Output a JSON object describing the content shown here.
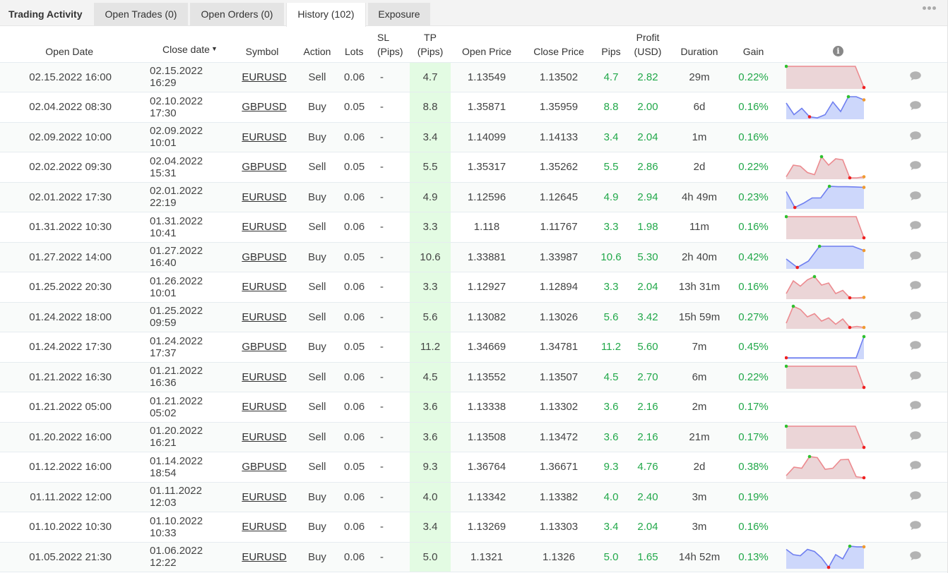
{
  "header": {
    "title": "Trading Activity",
    "tabs": [
      {
        "label": "Open Trades (0)",
        "active": false
      },
      {
        "label": "Open Orders (0)",
        "active": false
      },
      {
        "label": "History (102)",
        "active": true
      },
      {
        "label": "Exposure",
        "active": false
      }
    ],
    "more_icon": "ellipsis-icon"
  },
  "table": {
    "columns": {
      "open_date": "Open Date",
      "close_date": "Close date",
      "close_date_sort": "▼",
      "symbol": "Symbol",
      "action": "Action",
      "lots": "Lots",
      "sl_1": "SL",
      "sl_2": "(Pips)",
      "tp_1": "TP",
      "tp_2": "(Pips)",
      "open_price": "Open Price",
      "close_price": "Close Price",
      "pips": "Pips",
      "profit_1": "Profit",
      "profit_2": "(USD)",
      "duration": "Duration",
      "gain": "Gain",
      "info_icon": "i"
    },
    "colors": {
      "profit_green": "#22a84a",
      "tp_highlight": "#e3fbe3",
      "spark_buy": "#6f7ff0",
      "spark_buy_fill": "#cdd7fb",
      "spark_sell": "#ec8a8f",
      "spark_sell_fill": "#ebd5d7",
      "marker_max": "#2ec12e",
      "marker_min": "#f02020",
      "marker_end": "#f09a30"
    },
    "rows": [
      {
        "open_date": "02.15.2022 16:00",
        "close_date": "02.15.2022 16:29",
        "symbol": "EURUSD",
        "action": "Sell",
        "lots": "0.06",
        "sl": "-",
        "tp": "4.7",
        "open_price": "1.13549",
        "close_price": "1.13502",
        "pips": "4.7",
        "profit": "2.82",
        "duration": "29m",
        "gain": "0.22%",
        "spark": {
          "kind": "sell",
          "values": [
            1,
            1,
            1,
            1,
            1,
            1,
            1,
            1,
            1,
            0
          ],
          "max": 0,
          "min": 9,
          "end": null
        }
      },
      {
        "open_date": "02.04.2022 08:30",
        "close_date": "02.10.2022 17:30",
        "symbol": "GBPUSD",
        "action": "Buy",
        "lots": "0.05",
        "sl": "-",
        "tp": "8.8",
        "open_price": "1.35871",
        "close_price": "1.35959",
        "pips": "8.8",
        "profit": "2.00",
        "duration": "6d",
        "gain": "0.16%",
        "spark": {
          "kind": "buy",
          "values": [
            0.7,
            0.15,
            0.45,
            0.05,
            0.0,
            0.15,
            0.75,
            0.3,
            1.0,
            1.0,
            0.85
          ],
          "max": 8,
          "min": 3,
          "end": 10
        }
      },
      {
        "open_date": "02.09.2022 10:00",
        "close_date": "02.09.2022 10:01",
        "symbol": "EURUSD",
        "action": "Buy",
        "lots": "0.06",
        "sl": "-",
        "tp": "3.4",
        "open_price": "1.14099",
        "close_price": "1.14133",
        "pips": "3.4",
        "profit": "2.04",
        "duration": "1m",
        "gain": "0.16%",
        "spark": null
      },
      {
        "open_date": "02.02.2022 09:30",
        "close_date": "02.04.2022 15:31",
        "symbol": "GBPUSD",
        "action": "Sell",
        "lots": "0.05",
        "sl": "-",
        "tp": "5.5",
        "open_price": "1.35317",
        "close_price": "1.35262",
        "pips": "5.5",
        "profit": "2.86",
        "duration": "2d",
        "gain": "0.22%",
        "spark": {
          "kind": "sell",
          "values": [
            0.05,
            0.6,
            0.55,
            0.25,
            0.15,
            1.0,
            0.6,
            0.9,
            0.85,
            0.0,
            0.0,
            0.05
          ],
          "max": 5,
          "min": 9,
          "end": 11
        }
      },
      {
        "open_date": "02.01.2022 17:30",
        "close_date": "02.01.2022 22:19",
        "symbol": "EURUSD",
        "action": "Buy",
        "lots": "0.06",
        "sl": "-",
        "tp": "4.9",
        "open_price": "1.12596",
        "close_price": "1.12645",
        "pips": "4.9",
        "profit": "2.94",
        "duration": "4h 49m",
        "gain": "0.23%",
        "spark": {
          "kind": "buy",
          "values": [
            0.75,
            0.0,
            0.2,
            0.45,
            0.45,
            1.0,
            0.98,
            0.98,
            0.97,
            0.95
          ],
          "max": 5,
          "min": 1,
          "end": 9
        }
      },
      {
        "open_date": "01.31.2022 10:30",
        "close_date": "01.31.2022 10:41",
        "symbol": "EURUSD",
        "action": "Sell",
        "lots": "0.06",
        "sl": "-",
        "tp": "3.3",
        "open_price": "1.118",
        "close_price": "1.11767",
        "pips": "3.3",
        "profit": "1.98",
        "duration": "11m",
        "gain": "0.16%",
        "spark": {
          "kind": "sell",
          "values": [
            1,
            1,
            1,
            1,
            1,
            1,
            1,
            1,
            1,
            1,
            0
          ],
          "max": 0,
          "min": 10,
          "end": null
        }
      },
      {
        "open_date": "01.27.2022 14:00",
        "close_date": "01.27.2022 16:40",
        "symbol": "GBPUSD",
        "action": "Buy",
        "lots": "0.05",
        "sl": "-",
        "tp": "10.6",
        "open_price": "1.33881",
        "close_price": "1.33987",
        "pips": "10.6",
        "profit": "5.30",
        "duration": "2h 40m",
        "gain": "0.42%",
        "spark": {
          "kind": "buy",
          "values": [
            0.4,
            0.0,
            0.3,
            1.0,
            1.0,
            1.0,
            1.0,
            0.8
          ],
          "max": 3,
          "min": 1,
          "end": 7
        }
      },
      {
        "open_date": "01.25.2022 20:30",
        "close_date": "01.26.2022 10:01",
        "symbol": "EURUSD",
        "action": "Sell",
        "lots": "0.06",
        "sl": "-",
        "tp": "3.3",
        "open_price": "1.12927",
        "close_price": "1.12894",
        "pips": "3.3",
        "profit": "2.04",
        "duration": "13h 31m",
        "gain": "0.16%",
        "spark": {
          "kind": "sell",
          "values": [
            0.2,
            0.8,
            0.55,
            0.85,
            1.0,
            0.6,
            0.7,
            0.2,
            0.35,
            0.0,
            0.0,
            0.02
          ],
          "max": 4,
          "min": 9,
          "end": 11
        }
      },
      {
        "open_date": "01.24.2022 18:00",
        "close_date": "01.25.2022 09:59",
        "symbol": "EURUSD",
        "action": "Sell",
        "lots": "0.06",
        "sl": "-",
        "tp": "5.6",
        "open_price": "1.13082",
        "close_price": "1.13026",
        "pips": "5.6",
        "profit": "3.42",
        "duration": "15h 59m",
        "gain": "0.27%",
        "spark": {
          "kind": "sell",
          "values": [
            0.2,
            1.0,
            0.85,
            0.5,
            0.65,
            0.3,
            0.45,
            0.15,
            0.4,
            0.0,
            0.05,
            0.0
          ],
          "max": 1,
          "min": 9,
          "end": 11
        }
      },
      {
        "open_date": "01.24.2022 17:30",
        "close_date": "01.24.2022 17:37",
        "symbol": "GBPUSD",
        "action": "Buy",
        "lots": "0.05",
        "sl": "-",
        "tp": "11.2",
        "open_price": "1.34669",
        "close_price": "1.34781",
        "pips": "11.2",
        "profit": "5.60",
        "duration": "7m",
        "gain": "0.45%",
        "spark": {
          "kind": "buy",
          "values": [
            0,
            0,
            0,
            0,
            0,
            0,
            0,
            0,
            0,
            0,
            1
          ],
          "max": 10,
          "min": 0,
          "end": null
        }
      },
      {
        "open_date": "01.21.2022 16:30",
        "close_date": "01.21.2022 16:36",
        "symbol": "EURUSD",
        "action": "Sell",
        "lots": "0.06",
        "sl": "-",
        "tp": "4.5",
        "open_price": "1.13552",
        "close_price": "1.13507",
        "pips": "4.5",
        "profit": "2.70",
        "duration": "6m",
        "gain": "0.22%",
        "spark": {
          "kind": "sell",
          "values": [
            1,
            1,
            1,
            1,
            1,
            1,
            1,
            1,
            1,
            1,
            0
          ],
          "max": 0,
          "min": 10,
          "end": null
        }
      },
      {
        "open_date": "01.21.2022 05:00",
        "close_date": "01.21.2022 05:02",
        "symbol": "EURUSD",
        "action": "Sell",
        "lots": "0.06",
        "sl": "-",
        "tp": "3.6",
        "open_price": "1.13338",
        "close_price": "1.13302",
        "pips": "3.6",
        "profit": "2.16",
        "duration": "2m",
        "gain": "0.17%",
        "spark": null
      },
      {
        "open_date": "01.20.2022 16:00",
        "close_date": "01.20.2022 16:21",
        "symbol": "EURUSD",
        "action": "Sell",
        "lots": "0.06",
        "sl": "-",
        "tp": "3.6",
        "open_price": "1.13508",
        "close_price": "1.13472",
        "pips": "3.6",
        "profit": "2.16",
        "duration": "21m",
        "gain": "0.17%",
        "spark": {
          "kind": "sell",
          "values": [
            1,
            1,
            1,
            1,
            1,
            1,
            1,
            1,
            1,
            0
          ],
          "max": 0,
          "min": 9,
          "end": null
        }
      },
      {
        "open_date": "01.12.2022 16:00",
        "close_date": "01.14.2022 18:54",
        "symbol": "GBPUSD",
        "action": "Sell",
        "lots": "0.05",
        "sl": "-",
        "tp": "9.3",
        "open_price": "1.36764",
        "close_price": "1.36671",
        "pips": "9.3",
        "profit": "4.76",
        "duration": "2d",
        "gain": "0.38%",
        "spark": {
          "kind": "sell",
          "values": [
            0.1,
            0.5,
            0.45,
            1.0,
            0.95,
            0.4,
            0.45,
            0.85,
            0.87,
            0.05,
            0.0
          ],
          "max": 3,
          "min": 10,
          "end": null
        }
      },
      {
        "open_date": "01.11.2022 12:00",
        "close_date": "01.11.2022 12:03",
        "symbol": "EURUSD",
        "action": "Buy",
        "lots": "0.06",
        "sl": "-",
        "tp": "4.0",
        "open_price": "1.13342",
        "close_price": "1.13382",
        "pips": "4.0",
        "profit": "2.40",
        "duration": "3m",
        "gain": "0.19%",
        "spark": null
      },
      {
        "open_date": "01.10.2022 10:30",
        "close_date": "01.10.2022 10:33",
        "symbol": "EURUSD",
        "action": "Buy",
        "lots": "0.06",
        "sl": "-",
        "tp": "3.4",
        "open_price": "1.13269",
        "close_price": "1.13303",
        "pips": "3.4",
        "profit": "2.04",
        "duration": "3m",
        "gain": "0.16%",
        "spark": null
      },
      {
        "open_date": "01.05.2022 21:30",
        "close_date": "01.06.2022 12:22",
        "symbol": "EURUSD",
        "action": "Buy",
        "lots": "0.06",
        "sl": "-",
        "tp": "5.0",
        "open_price": "1.1321",
        "close_price": "1.1326",
        "pips": "5.0",
        "profit": "1.65",
        "duration": "14h 52m",
        "gain": "0.13%",
        "spark": {
          "kind": "buy",
          "values": [
            0.85,
            0.6,
            0.55,
            0.85,
            0.75,
            0.45,
            0.0,
            0.6,
            0.4,
            1.0,
            0.97,
            0.97
          ],
          "max": 9,
          "min": 6,
          "end": 11
        }
      }
    ]
  }
}
